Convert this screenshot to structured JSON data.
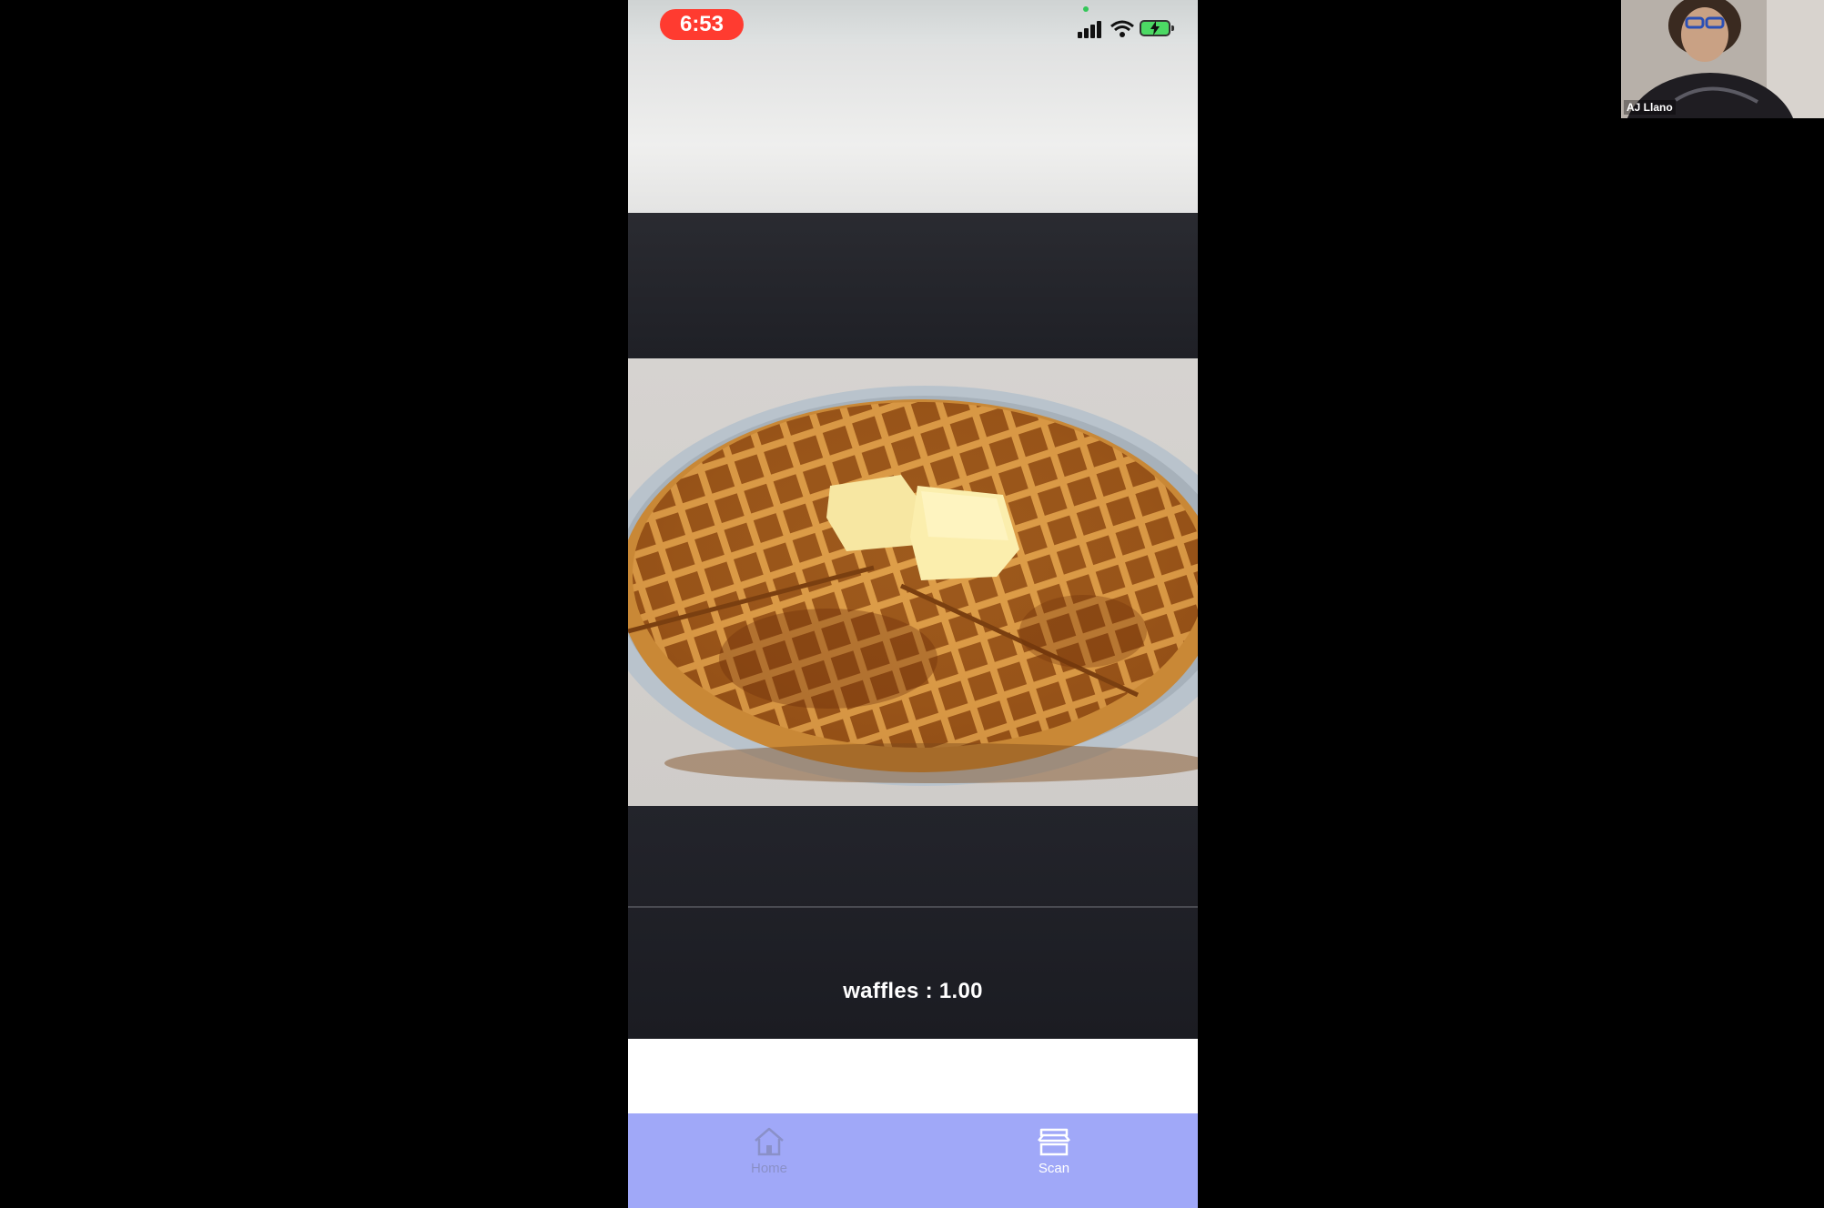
{
  "status_bar": {
    "time": "6:53",
    "signal_icon": "cellular-signal-icon",
    "wifi_icon": "wifi-icon",
    "battery_icon": "battery-charging-icon",
    "accent_color": "#ff3b30"
  },
  "camera": {
    "prediction_label": "waffles",
    "prediction_separator": " : ",
    "prediction_score": "1.00"
  },
  "tabbar": {
    "background": "#a0a8f8",
    "tabs": [
      {
        "label": "Home",
        "icon": "home-icon",
        "active": false
      },
      {
        "label": "Scan",
        "icon": "scan-icon",
        "active": true
      }
    ]
  },
  "participant": {
    "name": "AJ Llano"
  }
}
